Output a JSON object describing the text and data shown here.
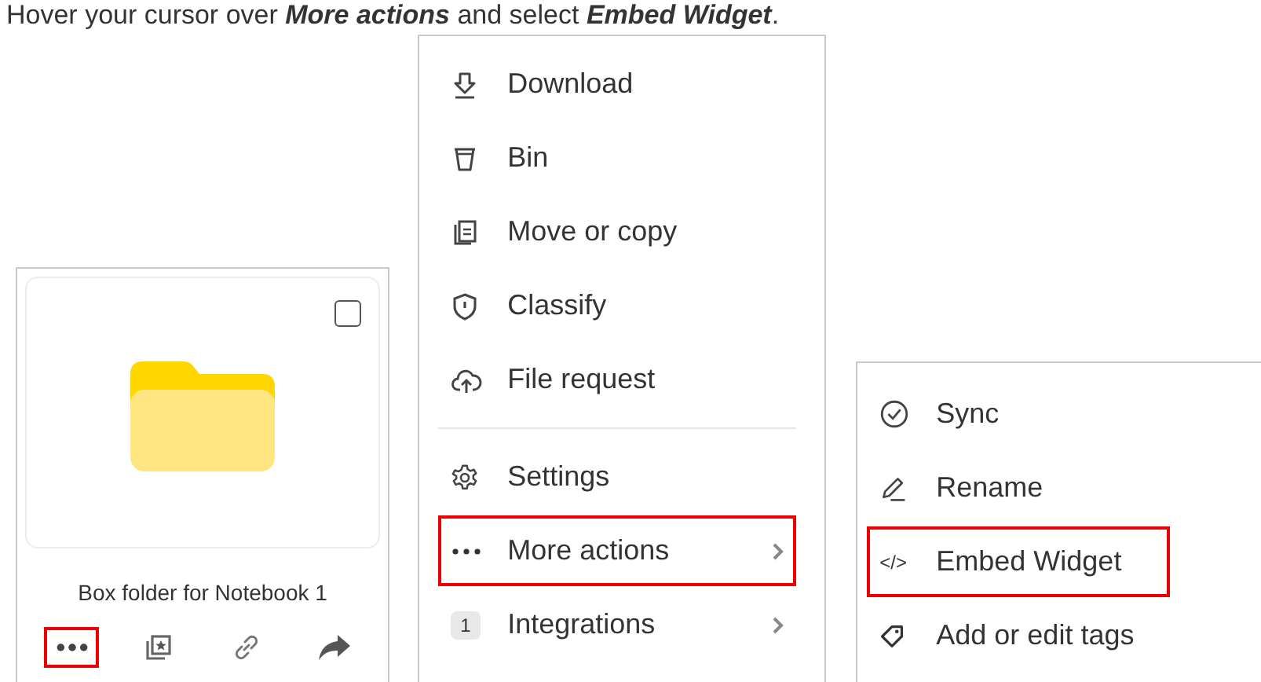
{
  "instruction": "Hover your cursor over **More actions** and select **Embed Widget**.",
  "card": {
    "name": "Box folder for Notebook 1",
    "checked": false,
    "actions": [
      {
        "kind": "more",
        "highlighted": true
      },
      {
        "kind": "collection",
        "highlighted": false
      },
      {
        "kind": "link",
        "highlighted": false
      },
      {
        "kind": "share",
        "highlighted": false
      }
    ]
  },
  "menu": {
    "groups": [
      [
        {
          "kind": "download",
          "label": "Download",
          "highlighted": false,
          "submenu": false
        },
        {
          "kind": "bin",
          "label": "Bin",
          "highlighted": false,
          "submenu": false
        },
        {
          "kind": "copy",
          "label": "Move or copy",
          "highlighted": false,
          "submenu": false
        },
        {
          "kind": "shield",
          "label": "Classify",
          "highlighted": false,
          "submenu": false
        },
        {
          "kind": "upload",
          "label": "File request",
          "highlighted": false,
          "submenu": false
        }
      ],
      [
        {
          "kind": "gear",
          "label": "Settings",
          "highlighted": false,
          "submenu": false
        },
        {
          "kind": "dots",
          "label": "More actions",
          "highlighted": true,
          "submenu": true
        },
        {
          "kind": "badge",
          "badge": "1",
          "label": "Integrations",
          "highlighted": false,
          "submenu": true
        }
      ]
    ]
  },
  "submenu": {
    "items": [
      {
        "kind": "sync",
        "label": "Sync",
        "highlighted": false
      },
      {
        "kind": "pencil",
        "label": "Rename",
        "highlighted": false
      },
      {
        "kind": "code",
        "icon_text": "</>",
        "label": "Embed Widget",
        "highlighted": true
      },
      {
        "kind": "tag",
        "label": "Add or edit tags",
        "highlighted": false
      }
    ]
  }
}
